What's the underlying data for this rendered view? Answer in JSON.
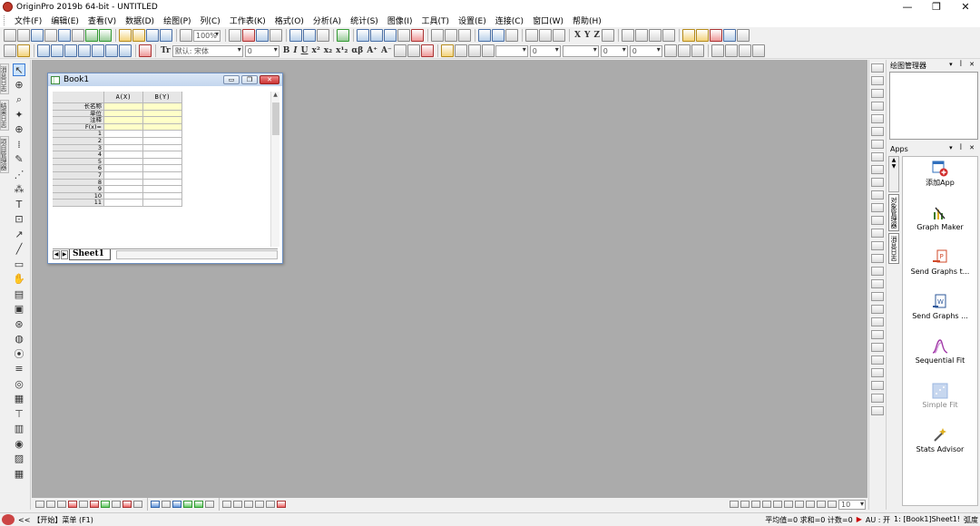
{
  "window": {
    "title": "OriginPro 2019b 64-bit - UNTITLED",
    "controls": [
      "—",
      "❐",
      "✕"
    ]
  },
  "menu": {
    "items": [
      "文件(F)",
      "编辑(E)",
      "查看(V)",
      "数据(D)",
      "绘图(P)",
      "列(C)",
      "工作表(K)",
      "格式(O)",
      "分析(A)",
      "统计(S)",
      "图像(I)",
      "工具(T)",
      "设置(E)",
      "连接(C)",
      "窗口(W)",
      "帮助(H)"
    ]
  },
  "toolbar": {
    "zoom_value": "100%",
    "font_value": "默认: 宋体",
    "font_size_value": "0",
    "font_size2_value": "0",
    "line_width_value": "0",
    "line_width2_value": "0"
  },
  "lefttabs": [
    "消息日志",
    "结果日志",
    "项目管理器"
  ],
  "book": {
    "title": "Book1",
    "columns": [
      "A(X)",
      "B(Y)"
    ],
    "meta_rows": [
      "长名称",
      "单位",
      "注释",
      "F(x)="
    ],
    "rows": [
      "1",
      "2",
      "3",
      "4",
      "5",
      "6",
      "7",
      "8",
      "9",
      "10",
      "11"
    ],
    "sheet_tab": "Sheet1"
  },
  "right_panel": {
    "graph_manager_title": "绘图管理器",
    "apps_title": "Apps",
    "side_tab": "对象管理器",
    "side_tab2": "消息日志",
    "apps": [
      {
        "label": "添加App",
        "icon": "add-app-icon",
        "color": "#2f6fbd",
        "disabled": false
      },
      {
        "label": "Graph Maker",
        "icon": "graph-maker-icon",
        "color": "#3a7a2a",
        "disabled": false
      },
      {
        "label": "Send Graphs t...",
        "icon": "send-graphs-ppt-icon",
        "color": "#d04a2a",
        "disabled": false
      },
      {
        "label": "Send Graphs ...",
        "icon": "send-graphs-word-icon",
        "color": "#2b579a",
        "disabled": false
      },
      {
        "label": "Sequential Fit",
        "icon": "sequential-fit-icon",
        "color": "#a23aa8",
        "disabled": false
      },
      {
        "label": "Simple Fit",
        "icon": "simple-fit-icon",
        "color": "#9bb7e0",
        "disabled": true
      },
      {
        "label": "Stats Advisor",
        "icon": "stats-advisor-icon",
        "color": "#e0b020",
        "disabled": false
      }
    ]
  },
  "bottom_toolbar": {
    "value": "10"
  },
  "status": {
    "left_prefix": "<<",
    "left_text": "【开始】菜单 (F1)",
    "right_stats": "平均值=0 求和=0 计数=0",
    "au": "AU : 开",
    "sheet_ref": "1: [Book1]Sheet1!",
    "angle": "弧度"
  }
}
